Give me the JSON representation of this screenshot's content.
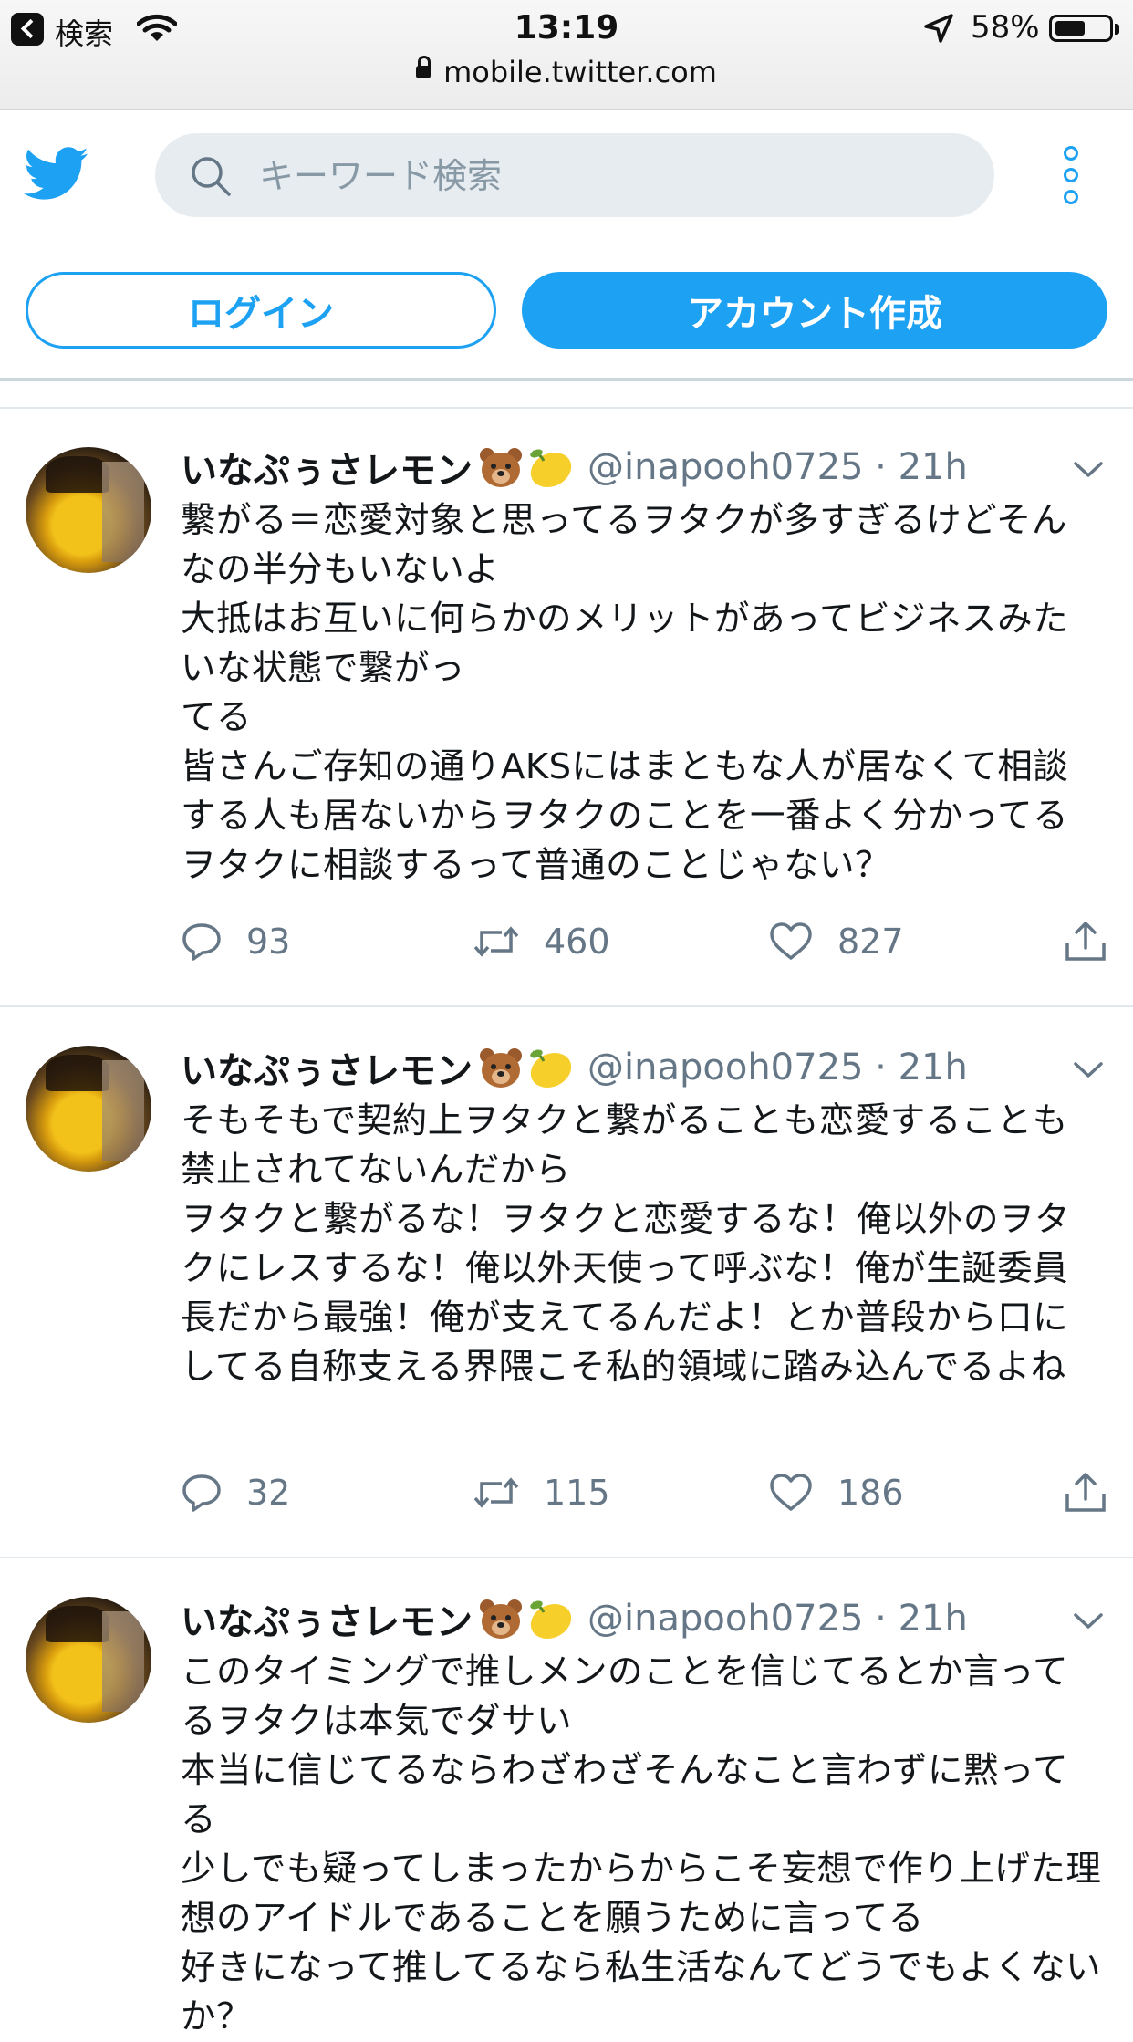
{
  "status_bar": {
    "back_label": "検索",
    "time": "13:19",
    "battery_percent": "58%",
    "battery_level": 0.58
  },
  "url_bar": {
    "url": "mobile.twitter.com"
  },
  "header": {
    "search_placeholder": "キーワード検索",
    "login_label": "ログイン",
    "signup_label": "アカウント作成",
    "accent_color": "#1da1f2"
  },
  "tweets": [
    {
      "name": "いなぷぅさレモン",
      "handle": "@inapooh0725 · 21h",
      "text": "繋がる＝恋愛対象と思ってるヲタクが多すぎるけどそんなの半分もいないよ\n大抵はお互いに何らかのメリットがあってビジネスみたいな状態で繋がっ\nてる\n皆さんご存知の通りAKSにはまともな人が居なくて相談する人も居ないからヲタクのことを一番よく分かってるヲタクに相談するって普通のことじゃない？",
      "replies": "93",
      "retweets": "460",
      "likes": "827"
    },
    {
      "name": "いなぷぅさレモン",
      "handle": "@inapooh0725 · 21h",
      "text": "そもそもで契約上ヲタクと繋がることも恋愛することも禁止されてないんだから\nヲタクと繋がるな！ヲタクと恋愛するな！俺以外のヲタクにレスするな！俺以外天使って呼ぶな！俺が生誕委員長だから最強！俺が支えてるんだよ！とか普段から口にしてる自称支える界隈こそ私的領域に踏み込んでるよね",
      "replies": "32",
      "retweets": "115",
      "likes": "186"
    },
    {
      "name": "いなぷぅさレモン",
      "handle": "@inapooh0725 · 21h",
      "text": "このタイミングで推しメンのことを信じてるとか言ってるヲタクは本気でダサい\n本当に信じてるならわざわざそんなこと言わずに黙ってる\n少しでも疑ってしまったからからこそ妄想で作り上げた理想のアイドルであることを願うために言ってる\n好きになって推してるなら私生活なんてどうでもよくないか？"
    }
  ]
}
